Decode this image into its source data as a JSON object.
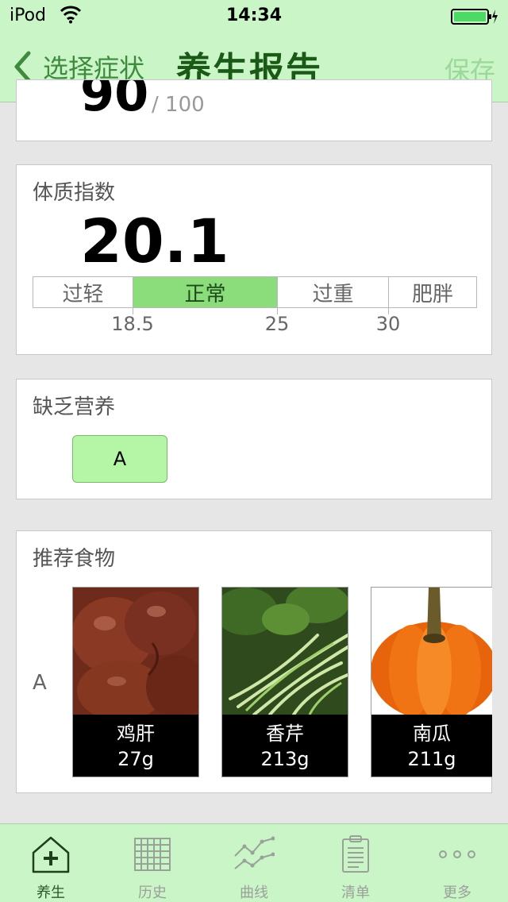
{
  "status": {
    "carrier": "iPod",
    "time": "14:34"
  },
  "nav": {
    "back_label": "选择症状",
    "title": "养生报告",
    "save_label": "保存"
  },
  "score": {
    "value": "90",
    "max": "/ 100"
  },
  "bmi": {
    "title": "体质指数",
    "value": "20.1",
    "segments": [
      "过轻",
      "正常",
      "过重",
      "肥胖"
    ],
    "active_segment": "正常",
    "ticks": [
      "18.5",
      "25",
      "30"
    ]
  },
  "nutrition": {
    "title": "缺乏营养",
    "tags": [
      "A"
    ]
  },
  "foods": {
    "title": "推荐食物",
    "row_label": "A",
    "items": [
      {
        "name": "鸡肝",
        "amount": "27g",
        "image": "chicken-liver"
      },
      {
        "name": "香芹",
        "amount": "213g",
        "image": "celery"
      },
      {
        "name": "南瓜",
        "amount": "211g",
        "image": "pumpkin"
      }
    ]
  },
  "tabs": [
    {
      "label": "养生",
      "icon": "home-plus-icon",
      "active": true
    },
    {
      "label": "历史",
      "icon": "grid-icon",
      "active": false
    },
    {
      "label": "曲线",
      "icon": "line-chart-icon",
      "active": false
    },
    {
      "label": "清单",
      "icon": "clipboard-icon",
      "active": false
    },
    {
      "label": "更多",
      "icon": "more-dots-icon",
      "active": false
    }
  ],
  "colors": {
    "bar": "#c9f5c7",
    "title": "#1a5a16",
    "accent": "#3f8b3e",
    "active_segment": "#8bdc7b",
    "tag": "#b4f5a6"
  }
}
